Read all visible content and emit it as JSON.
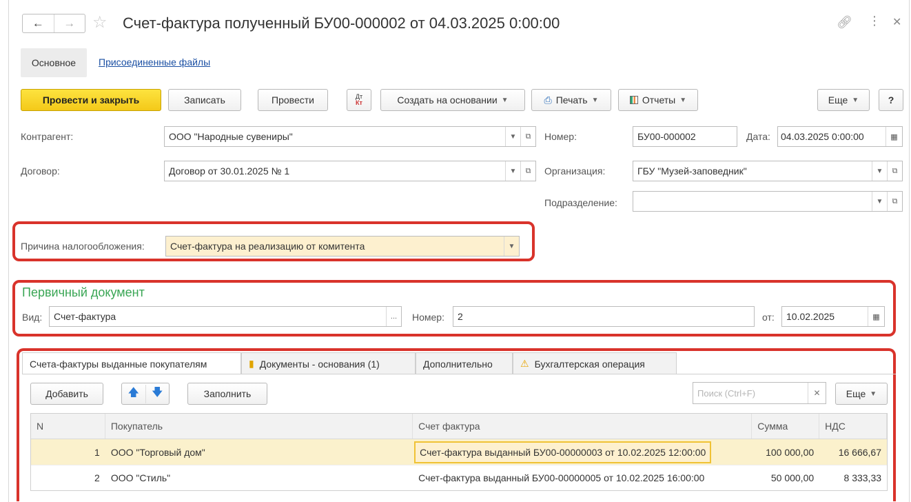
{
  "window": {
    "title": "Счет-фактура полученный БУ00-000002 от 04.03.2025 0:00:00",
    "back_icon": "arrow-left-icon",
    "forward_icon": "arrow-right-icon",
    "star_icon": "star-icon",
    "link_icon": "link-icon",
    "more_icon": "more-vertical-icon",
    "close_icon": "close-icon"
  },
  "top_tabs": {
    "main": "Основное",
    "files": "Присоединенные файлы"
  },
  "toolbar": {
    "post_close": "Провести и закрыть",
    "save": "Записать",
    "post": "Провести",
    "dt_kt": "Дт Кт",
    "create_based": "Создать на основании",
    "print": "Печать",
    "reports": "Отчеты",
    "more": "Еще",
    "help": "?"
  },
  "form": {
    "counterparty_label": "Контрагент:",
    "counterparty_value": "ООО \"Народные сувениры\"",
    "contract_label": "Договор:",
    "contract_value": "Договор от 30.01.2025 № 1",
    "number_label": "Номер:",
    "number_value": "БУ00-000002",
    "date_label": "Дата:",
    "date_value": "04.03.2025  0:00:00",
    "org_label": "Организация:",
    "org_value": "ГБУ \"Музей-заповедник\"",
    "dept_label": "Подразделение:",
    "dept_value": "",
    "tax_reason_label": "Причина налогообложения:",
    "tax_reason_value": "Счет-фактура на реализацию от комитента"
  },
  "primary_doc": {
    "title": "Первичный документ",
    "kind_label": "Вид:",
    "kind_value": "Счет-фактура",
    "number_label": "Номер:",
    "number_value": "2",
    "from_label": "от:",
    "from_value": "10.02.2025"
  },
  "table_tabs": [
    {
      "label": "Счета-фактуры выданные покупателям"
    },
    {
      "label": "Документы - основания (1)"
    },
    {
      "label": "Дополнительно"
    },
    {
      "label": "Бухгалтерская операция"
    }
  ],
  "table_toolbar": {
    "add": "Добавить",
    "fill": "Заполнить",
    "search_placeholder": "Поиск (Ctrl+F)",
    "more": "Еще"
  },
  "grid": {
    "columns": [
      "N",
      "Покупатель",
      "Счет фактура",
      "Сумма",
      "НДС"
    ],
    "rows": [
      {
        "n": "1",
        "buyer": "ООО \"Торговый дом\"",
        "invoice": "Счет-фактура выданный БУ00-00000003 от 10.02.2025 12:00:00",
        "sum": "100 000,00",
        "vat": "16 666,67"
      },
      {
        "n": "2",
        "buyer": "ООО \"Стиль\"",
        "invoice": "Счет-фактура выданный БУ00-00000005 от 10.02.2025 16:00:00",
        "sum": "50 000,00",
        "vat": "8 333,33"
      }
    ]
  },
  "colors": {
    "primary_button": "#f4c919",
    "highlight_box": "#d9332b",
    "section_title": "#3aa655",
    "link": "#1a4fa3",
    "selected_row": "#fbf1cc"
  }
}
